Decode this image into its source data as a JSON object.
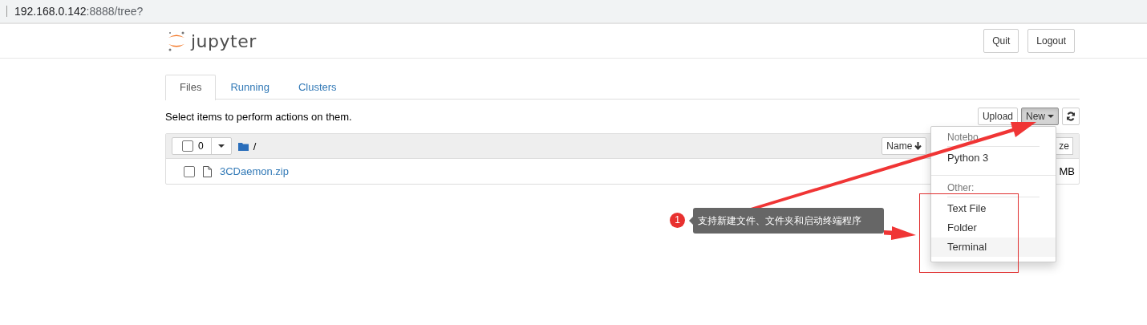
{
  "address_bar": {
    "host": "192.168.0.142",
    "path": ":8888/tree?"
  },
  "header": {
    "logo": "jupyter",
    "buttons": [
      "Quit",
      "Logout"
    ]
  },
  "tabs": [
    {
      "label": "Files",
      "selected": true
    },
    {
      "label": "Running",
      "selected": false
    },
    {
      "label": "Clusters",
      "selected": false
    }
  ],
  "toolbar": {
    "hint": "Select items to perform actions on them.",
    "upload": "Upload",
    "new": "New"
  },
  "list": {
    "select_count": "0",
    "checked": false,
    "path": "/",
    "sort_button": "Name",
    "size_header": "ze",
    "rows": [
      {
        "name": "3CDaemon.zip",
        "checked": false,
        "size": "MB"
      }
    ]
  },
  "new_menu": {
    "open": true,
    "sections": [
      {
        "header": "Notebo",
        "items": [
          {
            "label": "Python 3",
            "highlighted": false
          }
        ]
      },
      {
        "header": "Other:",
        "items": [
          {
            "label": "Text File",
            "highlighted": false
          },
          {
            "label": "Folder",
            "highlighted": false
          },
          {
            "label": "Terminal",
            "highlighted": true
          }
        ]
      }
    ]
  },
  "annotation": {
    "number": "1",
    "text": "支持新建文件、文件夹和启动终端程序"
  }
}
